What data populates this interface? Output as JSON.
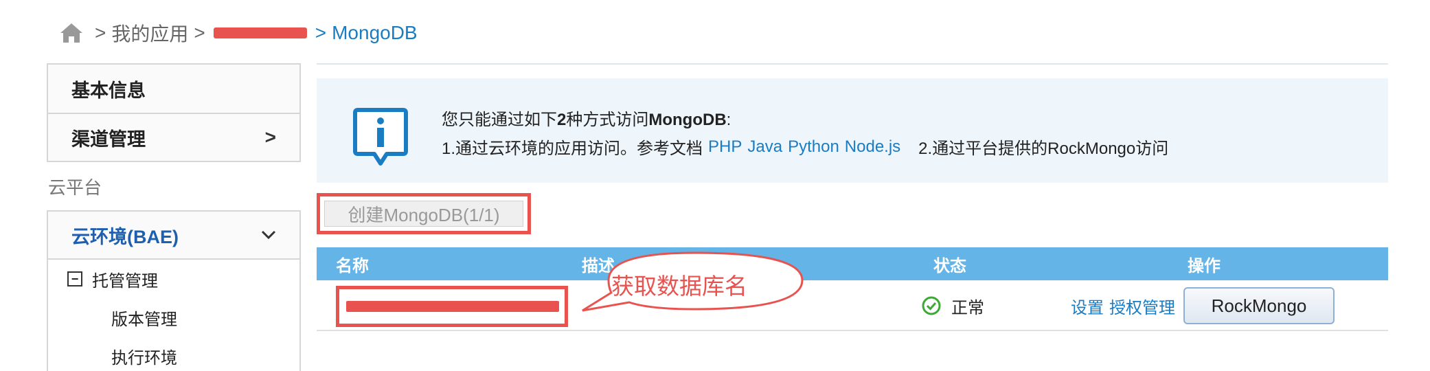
{
  "breadcrumb": {
    "sep": ">",
    "my_apps": "我的应用",
    "current": "MongoDB"
  },
  "sidebar": {
    "items": [
      {
        "label": "基本信息"
      },
      {
        "label": "渠道管理",
        "chevron": ">"
      }
    ],
    "section_label": "云平台",
    "env": {
      "label": "云环境(BAE)",
      "chevron": "⌄",
      "group": "托管管理",
      "children": [
        "版本管理",
        "执行环境"
      ]
    }
  },
  "info": {
    "title_prefix": "您只能通过如下",
    "title_strong": "2",
    "title_mid": "种方式访问",
    "title_db": "MongoDB",
    "title_suffix": ":",
    "line1_prefix": "1.通过云环境的应用访问。参考文档",
    "links": [
      "PHP",
      "Java",
      "Python",
      "Node.js"
    ],
    "line2": "2.通过平台提供的RockMongo访问"
  },
  "create_button": "创建MongoDB(1/1)",
  "table": {
    "headers": {
      "name": "名称",
      "desc": "描述",
      "status": "状态",
      "ops": "操作"
    },
    "rows": [
      {
        "status": "正常",
        "links": [
          "设置",
          "授权管理"
        ],
        "button": "RockMongo"
      }
    ]
  },
  "annotation": {
    "text": "获取数据库名"
  },
  "colors": {
    "accent": "#1a7cc2",
    "header": "#64b4e8",
    "annotation": "#e8534f",
    "info_bg": "#eef5fb"
  }
}
